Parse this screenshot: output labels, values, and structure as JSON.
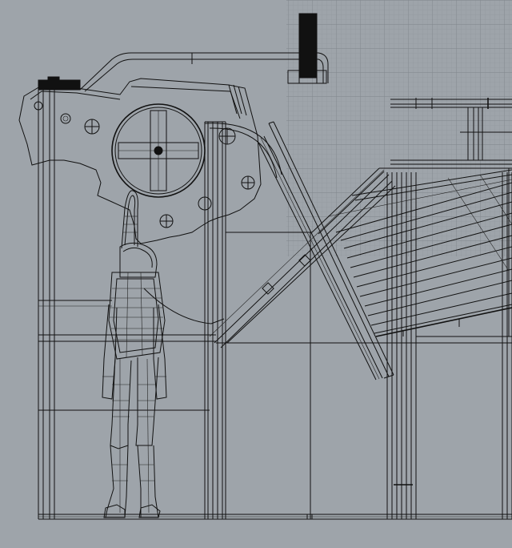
{
  "viewport": {
    "view": "wireframe-elevation",
    "background_color": "#9ea4aa",
    "grid_color": "#8f959b",
    "line_color": "#111111"
  },
  "objects": [
    "frame-structure",
    "human-figure",
    "sloped-panel",
    "pivot-wheel"
  ]
}
